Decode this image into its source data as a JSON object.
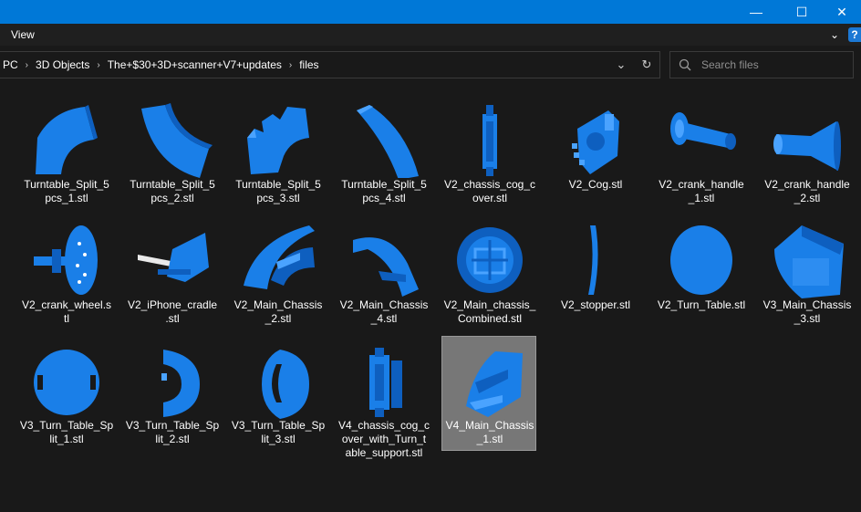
{
  "window": {
    "minimize_glyph": "—",
    "maximize_glyph": "☐",
    "close_glyph": "✕"
  },
  "ribbon": {
    "tab": "View",
    "collapse_glyph": "⌄",
    "help_glyph": "?"
  },
  "address": {
    "crumbs": [
      "PC",
      "3D Objects",
      "The+$30+3D+scanner+V7+updates",
      "files"
    ],
    "separator_glyph": "›",
    "dropdown_glyph": "⌄",
    "refresh_glyph": "↻"
  },
  "search": {
    "placeholder": "Search files"
  },
  "colors": {
    "accent": "#0078d7",
    "model_blue": "#1a7fe8",
    "background": "#191919",
    "selected": "#777777"
  },
  "files": [
    {
      "name": "Turntable_Split_5\npcs_1.stl",
      "icon": "stl-model-icon"
    },
    {
      "name": "Turntable_Split_5\npcs_2.stl",
      "icon": "stl-model-icon"
    },
    {
      "name": "Turntable_Split_5\npcs_3.stl",
      "icon": "stl-model-icon"
    },
    {
      "name": "Turntable_Split_5\npcs_4.stl",
      "icon": "stl-model-icon"
    },
    {
      "name": "V2_chassis_cog_c\nover.stl",
      "icon": "stl-model-icon"
    },
    {
      "name": "V2_Cog.stl",
      "icon": "stl-model-icon"
    },
    {
      "name": "V2_crank_handle\n_1.stl",
      "icon": "stl-model-icon"
    },
    {
      "name": "V2_crank_handle\n_2.stl",
      "icon": "stl-model-icon"
    },
    {
      "name": "V2_crank_wheel.s\ntl",
      "icon": "stl-model-icon"
    },
    {
      "name": "V2_iPhone_cradle\n.stl",
      "icon": "stl-model-icon"
    },
    {
      "name": "V2_Main_Chassis\n_2.stl",
      "icon": "stl-model-icon"
    },
    {
      "name": "V2_Main_Chassis\n_4.stl",
      "icon": "stl-model-icon"
    },
    {
      "name": "V2_Main_chassis_\nCombined.stl",
      "icon": "stl-model-icon"
    },
    {
      "name": "V2_stopper.stl",
      "icon": "stl-model-icon"
    },
    {
      "name": "V2_Turn_Table.stl",
      "icon": "stl-model-icon"
    },
    {
      "name": "V3_Main_Chassis\n_3.stl",
      "icon": "stl-model-icon"
    },
    {
      "name": "V3_Turn_Table_Sp\nlit_1.stl",
      "icon": "stl-model-icon"
    },
    {
      "name": "V3_Turn_Table_Sp\nlit_2.stl",
      "icon": "stl-model-icon"
    },
    {
      "name": "V3_Turn_Table_Sp\nlit_3.stl",
      "icon": "stl-model-icon"
    },
    {
      "name": "V4_chassis_cog_c\nover_with_Turn_t\nable_support.stl",
      "icon": "stl-model-icon"
    },
    {
      "name": "V4_Main_Chassis\n_1.stl",
      "icon": "stl-model-icon",
      "selected": true
    }
  ]
}
